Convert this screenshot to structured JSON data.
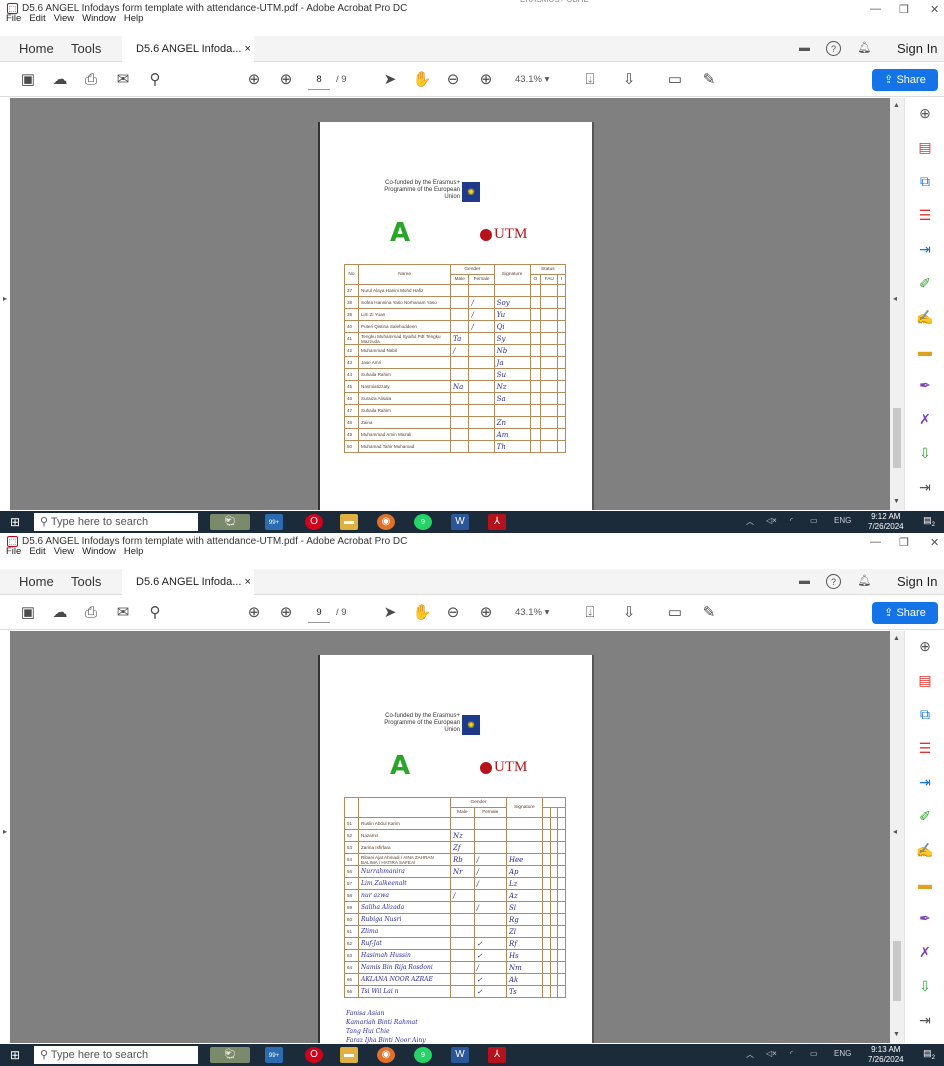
{
  "shots": [
    {
      "cut_text": "ERASMUS+ CBHE",
      "title": "D5.6 ANGEL Infodays form template with attendance-UTM.pdf - Adobe Acrobat Pro DC",
      "menu": [
        "File",
        "Edit",
        "View",
        "Window",
        "Help"
      ],
      "nav": {
        "home": "Home",
        "tools": "Tools"
      },
      "doc_tab": "D5.6 ANGEL Infoda...",
      "sign_in": "Sign In",
      "share": "Share",
      "page_current": "8",
      "page_total": "/ 9",
      "zoom": "43.1%",
      "doc": {
        "eu_text": "Co-funded by the Erasmus+ Programme of the European Union",
        "utm": "UTM",
        "headers": {
          "no": "No",
          "name": "Name",
          "gender": "Gender",
          "male": "Male",
          "female": "Female",
          "signature": "Signature",
          "status": "Status",
          "s1": "O",
          "s2": "FAU",
          "s3": "I"
        },
        "rows": [
          {
            "no": "37",
            "name": "Nurul Alaya Hanini Mohd Hafiz",
            "m": "",
            "f": "",
            "sig": ""
          },
          {
            "no": "38",
            "name": "Sofea Hannina Yaso Norhanam Yaso",
            "m": "",
            "f": "/",
            "sig": "Soy"
          },
          {
            "no": "39",
            "name": "Lim Zi Yuan",
            "m": "",
            "f": "/",
            "sig": "Yu"
          },
          {
            "no": "40",
            "name": "Puteri Qistina Salehuddeen",
            "m": "",
            "f": "/",
            "sig": "Qi"
          },
          {
            "no": "41",
            "name": "Tengku Muhammad Syaiful Pdt Tengku Mazzuda",
            "m": "Ta",
            "f": "",
            "sig": "Sy"
          },
          {
            "no": "42",
            "name": "Muhammad Nabil",
            "m": "/",
            "f": "",
            "sig": "Nb"
          },
          {
            "no": "43",
            "name": "Jase Amri",
            "m": "",
            "f": "",
            "sig": "Ja"
          },
          {
            "no": "44",
            "name": "Suhaila Rahim",
            "m": "",
            "f": "",
            "sig": "Su"
          },
          {
            "no": "45",
            "name": "Nasmiatizzaty",
            "m": "Na",
            "f": "",
            "sig": "Nz"
          },
          {
            "no": "46",
            "name": "Suraiza Alisala",
            "m": "",
            "f": "",
            "sig": "Sa"
          },
          {
            "no": "47",
            "name": "Suhaila Rahim",
            "m": "",
            "f": "",
            "sig": ""
          },
          {
            "no": "48",
            "name": "Zaina",
            "m": "",
            "f": "",
            "sig": "Zn"
          },
          {
            "no": "49",
            "name": "Muhammad Amin Mazali",
            "m": "",
            "f": "",
            "sig": "Am"
          },
          {
            "no": "50",
            "name": "Muhamad Tahir Muhamad",
            "m": "",
            "f": "",
            "sig": "Th"
          }
        ]
      },
      "taskbar": {
        "search": "Type here to search",
        "mail_badge": "99+",
        "wa_badge": "9",
        "lang": "ENG",
        "time": "9:12 AM",
        "date": "7/26/2024",
        "notif": "2"
      }
    },
    {
      "cut_text": "",
      "title": "D5.6 ANGEL Infodays form template with attendance-UTM.pdf - Adobe Acrobat Pro DC",
      "menu": [
        "File",
        "Edit",
        "View",
        "Window",
        "Help"
      ],
      "nav": {
        "home": "Home",
        "tools": "Tools"
      },
      "doc_tab": "D5.6 ANGEL Infoda...",
      "sign_in": "Sign In",
      "share": "Share",
      "page_current": "9",
      "page_total": "/ 9",
      "zoom": "43.1%",
      "doc": {
        "eu_text": "Co-funded by the Erasmus+ Programme of the European Union",
        "utm": "UTM",
        "headers": {
          "no": "",
          "name": "",
          "gender": "Gender",
          "male": "Male",
          "female": "Female",
          "signature": "Signature",
          "status": "",
          "s1": "",
          "s2": "",
          "s3": ""
        },
        "rows": [
          {
            "no": "51",
            "name": "Ruslin Abdul Karim",
            "m": "",
            "f": "",
            "sig": ""
          },
          {
            "no": "52",
            "name": "Nazamir",
            "m": "Nz",
            "f": "",
            "sig": ""
          },
          {
            "no": "53",
            "name": "Zarina Isfirfara",
            "m": "Zf",
            "f": "",
            "sig": ""
          },
          {
            "no": "54",
            "name": "Ribani Ajat Ahmadi / AINA ZAHRAN BALIMA / HATIRA SAFEAI",
            "m": "Rb",
            "f": "/",
            "sig": "Hee"
          },
          {
            "no": "56",
            "name": "Nurrahmanira",
            "m": "Nr",
            "f": "/",
            "sig": "Ap"
          },
          {
            "no": "57",
            "name": "Lim Zalkeenalt",
            "m": "",
            "f": "/",
            "sig": "Lz"
          },
          {
            "no": "58",
            "name": "nur azwa",
            "m": "/",
            "f": "",
            "sig": "Az"
          },
          {
            "no": "59",
            "name": "Saliha Alizada",
            "m": "",
            "f": "/",
            "sig": "Sl"
          },
          {
            "no": "60",
            "name": "Rubiga Nusri",
            "m": "",
            "f": "",
            "sig": "Rg"
          },
          {
            "no": "61",
            "name": "Zlima",
            "m": "",
            "f": "",
            "sig": "Zl"
          },
          {
            "no": "62",
            "name": "Ruf-Jat",
            "m": "",
            "f": "✓",
            "sig": "Rf"
          },
          {
            "no": "63",
            "name": "Hasimah Hussin",
            "m": "",
            "f": "✓",
            "sig": "Hs"
          },
          {
            "no": "64",
            "name": "Namis Bin Rija Rosdoni",
            "m": "",
            "f": "/",
            "sig": "Nm"
          },
          {
            "no": "65",
            "name": "AKLANA NOOR AZRAE",
            "m": "",
            "f": "✓",
            "sig": "Ak"
          },
          {
            "no": "66",
            "name": "Tsi Wil Lai n",
            "m": "",
            "f": "✓",
            "sig": "Ts"
          }
        ],
        "extra": [
          "Fanisa Asian",
          "Kamariah Binti Rahmat",
          "Tang Hui Chie",
          "Faraz Ijha Binti Noor Ainy"
        ]
      },
      "taskbar": {
        "search": "Type here to search",
        "mail_badge": "99+",
        "wa_badge": "9",
        "lang": "ENG",
        "time": "9:13 AM",
        "date": "7/26/2024",
        "notif": "2"
      }
    }
  ],
  "colors": {
    "share": "#1473e6",
    "taskbar": "#1c2b3a",
    "canvas": "#808080"
  }
}
